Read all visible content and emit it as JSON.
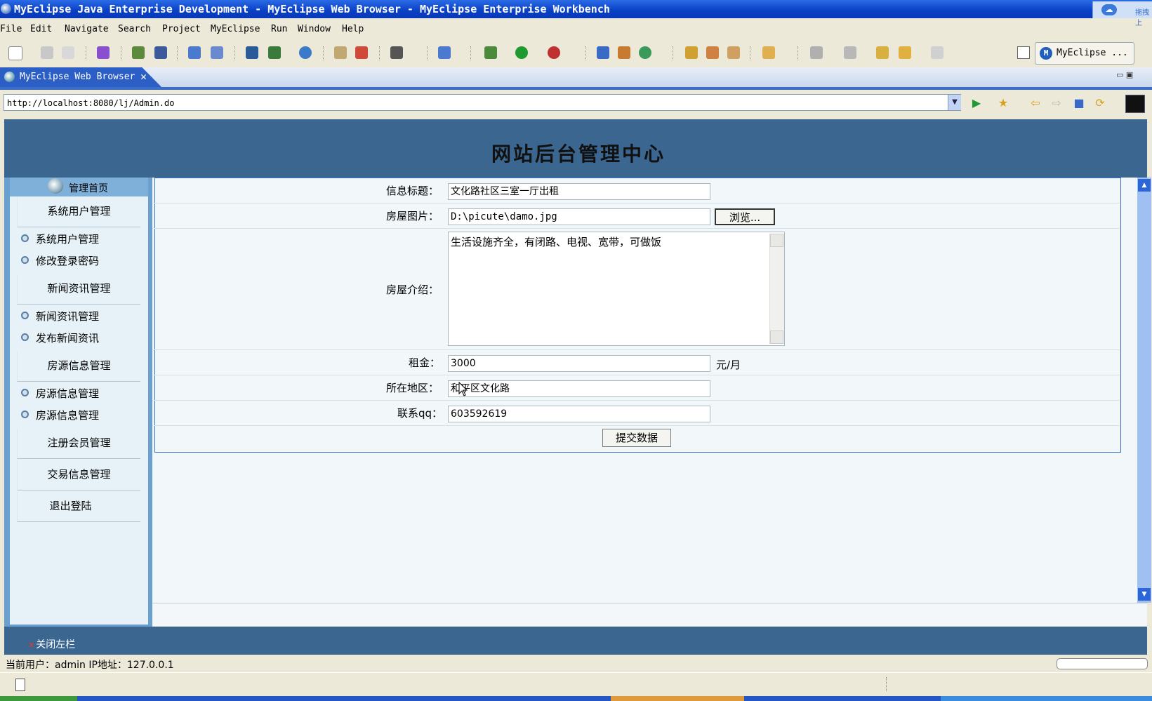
{
  "window": {
    "title": "MyEclipse Java Enterprise Development - MyEclipse Web Browser - MyEclipse Enterprise Workbench"
  },
  "tray": {
    "label": "拖拽上"
  },
  "menu": {
    "items": [
      "File",
      "Edit",
      "Navigate",
      "Search",
      "Project",
      "MyEclipse",
      "Run",
      "Window",
      "Help"
    ]
  },
  "toolbar": {
    "perspective_label": "MyEclipse ...",
    "perspective_badge": "M"
  },
  "editor_tab": {
    "label": "MyEclipse Web Browser",
    "close": "✕"
  },
  "browser": {
    "url": "http://localhost:8080/lj/Admin.do"
  },
  "site": {
    "title": "网站后台管理中心"
  },
  "sidebar": {
    "home": "管理首页",
    "sections": [
      {
        "label": "系统用户管理",
        "items": [
          "系统用户管理",
          "修改登录密码"
        ]
      },
      {
        "label": "新闻资讯管理",
        "items": [
          "新闻资讯管理",
          "发布新闻资讯"
        ]
      },
      {
        "label": "房源信息管理",
        "items": [
          "房源信息管理",
          "房源信息管理"
        ]
      },
      {
        "label": "注册会员管理",
        "items": []
      },
      {
        "label": "交易信息管理",
        "items": []
      },
      {
        "label": "退出登陆",
        "items": []
      }
    ]
  },
  "form": {
    "title_label": "信息标题：",
    "title_value": "文化路社区三室一厅出租",
    "image_label": "房屋图片：",
    "image_value": "D:\\picute\\damo.jpg",
    "browse_button": "浏览...",
    "intro_label": "房屋介绍：",
    "intro_value": "生活设施齐全，有闭路、电视、宽带，可做饭",
    "rent_label": "租金：",
    "rent_value": "3000",
    "rent_unit": "元/月",
    "area_label": "所在地区：",
    "area_value": "和平区文化路",
    "qq_label": "联系qq：",
    "qq_value": "603592619",
    "submit_button": "提交数据"
  },
  "footer": {
    "close_left": "关闭左栏",
    "close_icon": "✕"
  },
  "userbar": {
    "text": "当前用户：admin  IP地址：127.0.0.1"
  }
}
